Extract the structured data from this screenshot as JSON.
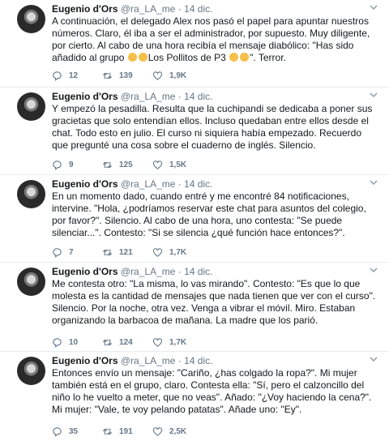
{
  "tweets": [
    {
      "name": "Eugenio d'Ors",
      "handle": "@ra_LA_me",
      "dot": "·",
      "date": "14 dic.",
      "text": "A continuación, el delegado Alex nos pasó el papel para apuntar nuestros números. Claro, él iba a ser el administrador, por supuesto. Muy diligente, por cierto. Al cabo de una hora recibía el mensaje diabólico: \"Has sido añadido al grupo 🐥🐥Los Pollitos de P3 🐥🐥\". Terror.",
      "text_before": "A continuación, el delegado Alex nos pasó el papel para apuntar nuestros números. Claro, él iba a ser el administrador, por supuesto. Muy diligente, por cierto. Al cabo de una hora recibía el mensaje diabólico: \"Has sido añadido al grupo ",
      "text_mid": "Los Pollitos de P3 ",
      "text_after": "\". Terror.",
      "replies": "12",
      "retweets": "139",
      "likes": "1,9K"
    },
    {
      "name": "Eugenio d'Ors",
      "handle": "@ra_LA_me",
      "dot": "·",
      "date": "14 dic.",
      "text": "Y empezó la pesadilla. Resulta que la cuchipandi se dedicaba a poner sus gracietas que solo entendían ellos. Incluso quedaban entre ellos desde el chat. Todo esto en julio. El curso ni siquiera había empezado. Recuerdo que pregunté una cosa sobre el cuaderno de inglés. Silencio.",
      "replies": "9",
      "retweets": "125",
      "likes": "1,5K"
    },
    {
      "name": "Eugenio d'Ors",
      "handle": "@ra_LA_me",
      "dot": "·",
      "date": "14 dic.",
      "text": "En un momento dado, cuando entré y me encontré 84 notificaciones, intervine. \"Hola, ¿podríamos reservar este chat para asuntos del colegio, por favor?\". Silencio. Al cabo de una hora, uno contesta: \"Se puede silenciar...\". Contesto: \"Si se silencia ¿qué función hace entonces?\".",
      "replies": "7",
      "retweets": "121",
      "likes": "1,7K"
    },
    {
      "name": "Eugenio d'Ors",
      "handle": "@ra_LA_me",
      "dot": "·",
      "date": "14 dic.",
      "text": "Me contesta otro: \"La misma, lo vas mirando\". Contesto: \"Es que lo que molesta es la cantidad de mensajes que nada tienen que ver con el curso\". Silencio. Por la noche, otra vez. Venga a vibrar el móvil. Miro. Estaban organizando la barbacoa de mañana. La madre que los parió.",
      "replies": "10",
      "retweets": "124",
      "likes": "1,7K"
    },
    {
      "name": "Eugenio d'Ors",
      "handle": "@ra_LA_me",
      "dot": "·",
      "date": "14 dic.",
      "text": "Entonces envío un mensaje: \"Cariño, ¿has colgado la ropa?\". Mi mujer también está en el grupo, claro. Contesta ella: \"Sí, pero el calzoncillo del niño lo he vuelto a meter, que no veas\". Añado: \"¿Voy haciendo la cena?\". Mi mujer: \"Vale, te voy pelando patatas\". Añade uno: \"Ey\".",
      "replies": "35",
      "retweets": "191",
      "likes": "2,5K"
    }
  ],
  "icons": {
    "reply": "reply-icon",
    "retweet": "retweet-icon",
    "like": "heart-icon",
    "menu": "chevron-down-icon",
    "emoji": "baby-chick-emoji"
  },
  "colors": {
    "name": "#14171a",
    "meta": "#657786",
    "divider": "#e6ecf0",
    "chick": "#f5c04a"
  }
}
